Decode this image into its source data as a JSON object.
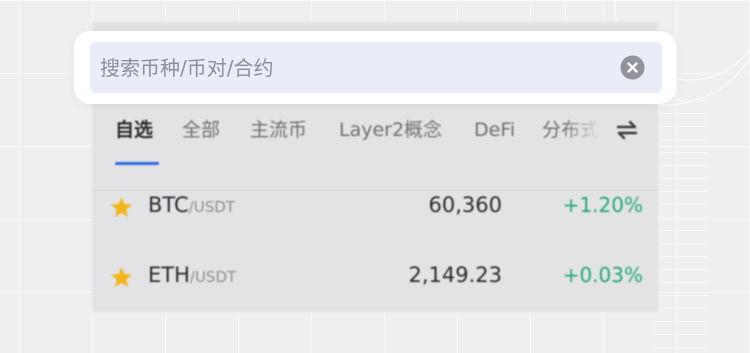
{
  "search": {
    "placeholder": "搜索币种/币对/合约",
    "value": ""
  },
  "tabs": [
    {
      "label": "自选",
      "active": true
    },
    {
      "label": "全部",
      "active": false
    },
    {
      "label": "主流币",
      "active": false
    },
    {
      "label": "Layer2概念",
      "active": false
    },
    {
      "label": "DeFi",
      "active": false
    },
    {
      "label": "分布式",
      "active": false
    }
  ],
  "rows": [
    {
      "base": "BTC",
      "quote": "/USDT",
      "price": "60,360",
      "change": "+1.20%",
      "favorite": true
    },
    {
      "base": "ETH",
      "quote": "/USDT",
      "price": "2,149.23",
      "change": "+0.03%",
      "favorite": true
    }
  ],
  "icons": {
    "clear": "close-circle-icon",
    "refresh": "swap-arrows-icon",
    "favorite": "star-icon"
  },
  "colors": {
    "accent": "#2f6be6",
    "positive": "#22a77a",
    "star": "#f2b51c",
    "search_bg": "#eaedf7"
  }
}
